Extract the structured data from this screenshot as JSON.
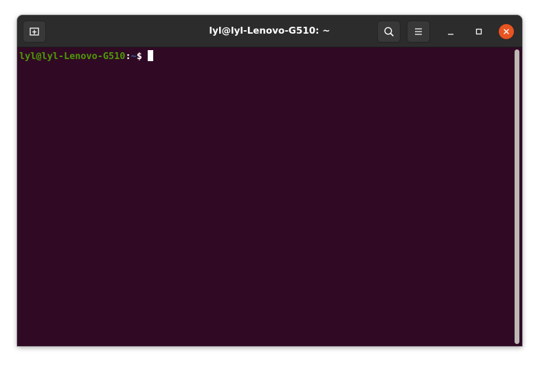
{
  "window": {
    "title": "lyl@lyl-Lenovo-G510: ~"
  },
  "headerbar": {
    "icons": {
      "new_tab": "new-tab-icon",
      "search": "search-icon",
      "menu": "hamburger-menu-icon",
      "minimize": "minimize-icon",
      "maximize": "maximize-icon",
      "close": "close-icon"
    }
  },
  "terminal": {
    "prompt_user_host": "lyl@lyl-Lenovo-G510",
    "prompt_separator": ":",
    "prompt_path": "~",
    "prompt_symbol": "$",
    "colors": {
      "background": "#300a24",
      "user_host": "#4e9a06",
      "path": "#3465a4",
      "text": "#ffffff"
    }
  },
  "colors": {
    "headerbar": "#2c2c2c",
    "close_button": "#e95420"
  }
}
